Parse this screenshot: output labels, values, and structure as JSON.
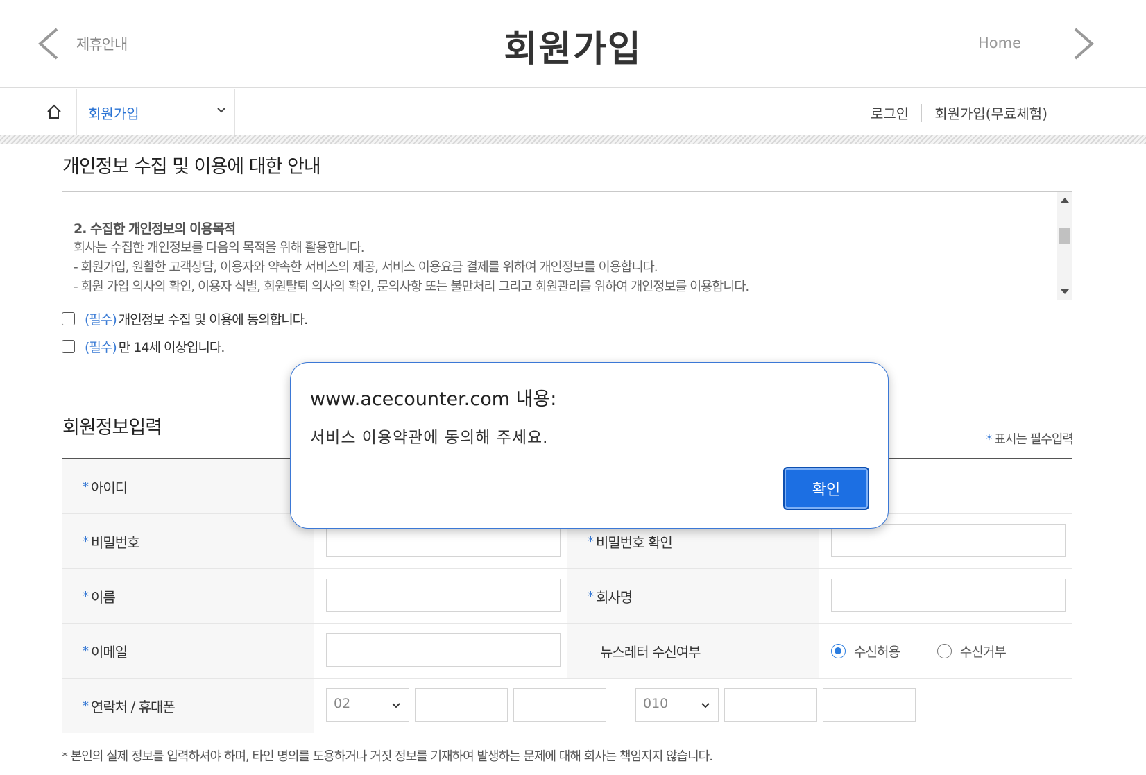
{
  "header": {
    "back_label": "제휴안내",
    "title": "회원가입",
    "home_label": "Home"
  },
  "nav": {
    "selected": "회원가입",
    "links": [
      "로그인",
      "회원가입(무료체험)"
    ]
  },
  "privacy": {
    "title": "개인정보 수집 및 이용에 대한 안내",
    "terms_heading": "2. 수집한 개인정보의 이용목적",
    "terms_lines": [
      "회사는 수집한 개인정보를 다음의 목적을 위해 활용합니다.",
      "- 회원가입, 원활한 고객상담, 이용자와 약속한 서비스의 제공, 서비스 이용요금 결제를 위하여 개인정보를 이용합니다.",
      "- 회원 가입 의사의 확인, 이용자 식별, 회원탈퇴 의사의 확인, 문의사항 또는 불만처리 그리고 회원관리를 위하여 개인정보를 이용합니다."
    ],
    "agreements": [
      {
        "tag": "(필수)",
        "text": "개인정보 수집 및 이용에 동의합니다."
      },
      {
        "tag": "(필수)",
        "text": "만 14세 이상입니다."
      }
    ]
  },
  "member": {
    "title": "회원정보입력",
    "required_note": "표시는 필수입력",
    "star": "*",
    "fields": {
      "id": "아이디",
      "password": "비밀번호",
      "password_confirm": "비밀번호 확인",
      "name": "이름",
      "company": "회사명",
      "email": "이메일",
      "newsletter": "뉴스레터 수신여부",
      "phone": "연락처 / 휴대폰"
    },
    "newsletter_options": [
      "수신허용",
      "수신거부"
    ],
    "newsletter_selected": "수신허용",
    "phone_area_code": "02",
    "mobile_prefix": "010",
    "bottom_note": "* 본인의 실제 정보를 입력하셔야 하며, 타인 명의를 도용하거나 거짓 정보를 기재하여 발생하는 문제에 대해 회사는 책임지지 않습니다."
  },
  "dialog": {
    "title": "www.acecounter.com 내용:",
    "message": "서비스 이용약관에 동의해 주세요.",
    "ok_label": "확인"
  },
  "colors": {
    "accent": "#2a73d4",
    "dialog_button": "#1c6fe3"
  }
}
